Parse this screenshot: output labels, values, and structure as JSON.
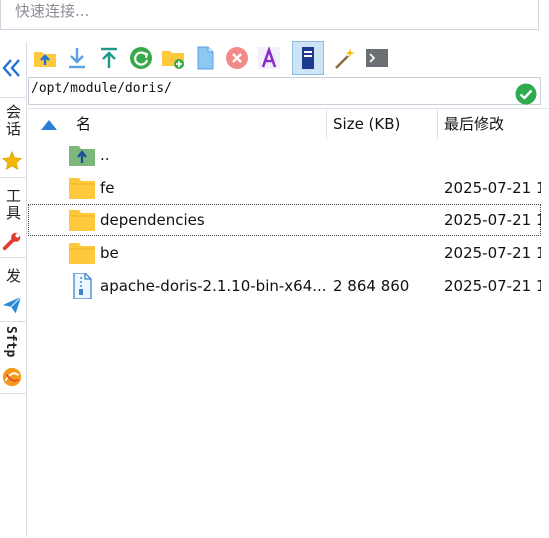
{
  "quick_connect": {
    "placeholder": "快速连接..."
  },
  "left_tabs": {
    "collapse_icon": "double-chevron-left",
    "items": [
      {
        "label": "会话",
        "icon": "star-icon"
      },
      {
        "label": "工具",
        "icon": "wrench-icon"
      },
      {
        "label": "发",
        "icon": "paper-plane-icon"
      },
      {
        "label": "Sftp",
        "icon": "sftp-icon"
      }
    ]
  },
  "toolbar": {
    "buttons": [
      "parent-folder-icon",
      "download-icon",
      "upload-icon",
      "refresh-icon",
      "new-folder-icon",
      "new-file-icon",
      "delete-icon",
      "rename-icon",
      "view-mode-icon",
      "wand-icon",
      "terminal-icon"
    ]
  },
  "path": {
    "value": "/opt/module/doris/"
  },
  "columns": {
    "name": "名",
    "size": "Size (KB)",
    "modified": "最后修改"
  },
  "files": [
    {
      "name": "..",
      "size": "",
      "modified": "",
      "type": "parent"
    },
    {
      "name": "fe",
      "size": "",
      "modified": "2025-07-21 1",
      "type": "folder"
    },
    {
      "name": "dependencies",
      "size": "",
      "modified": "2025-07-21 1",
      "type": "folder"
    },
    {
      "name": "be",
      "size": "",
      "modified": "2025-07-21 1",
      "type": "folder"
    },
    {
      "name": "apache-doris-2.1.10-bin-x64....",
      "size": "2 864 860",
      "modified": "2025-07-21 1",
      "type": "file"
    }
  ],
  "colors": {
    "folder": "#ffc83d",
    "accent": "#1e88e5",
    "ok": "#2eaa4f"
  }
}
